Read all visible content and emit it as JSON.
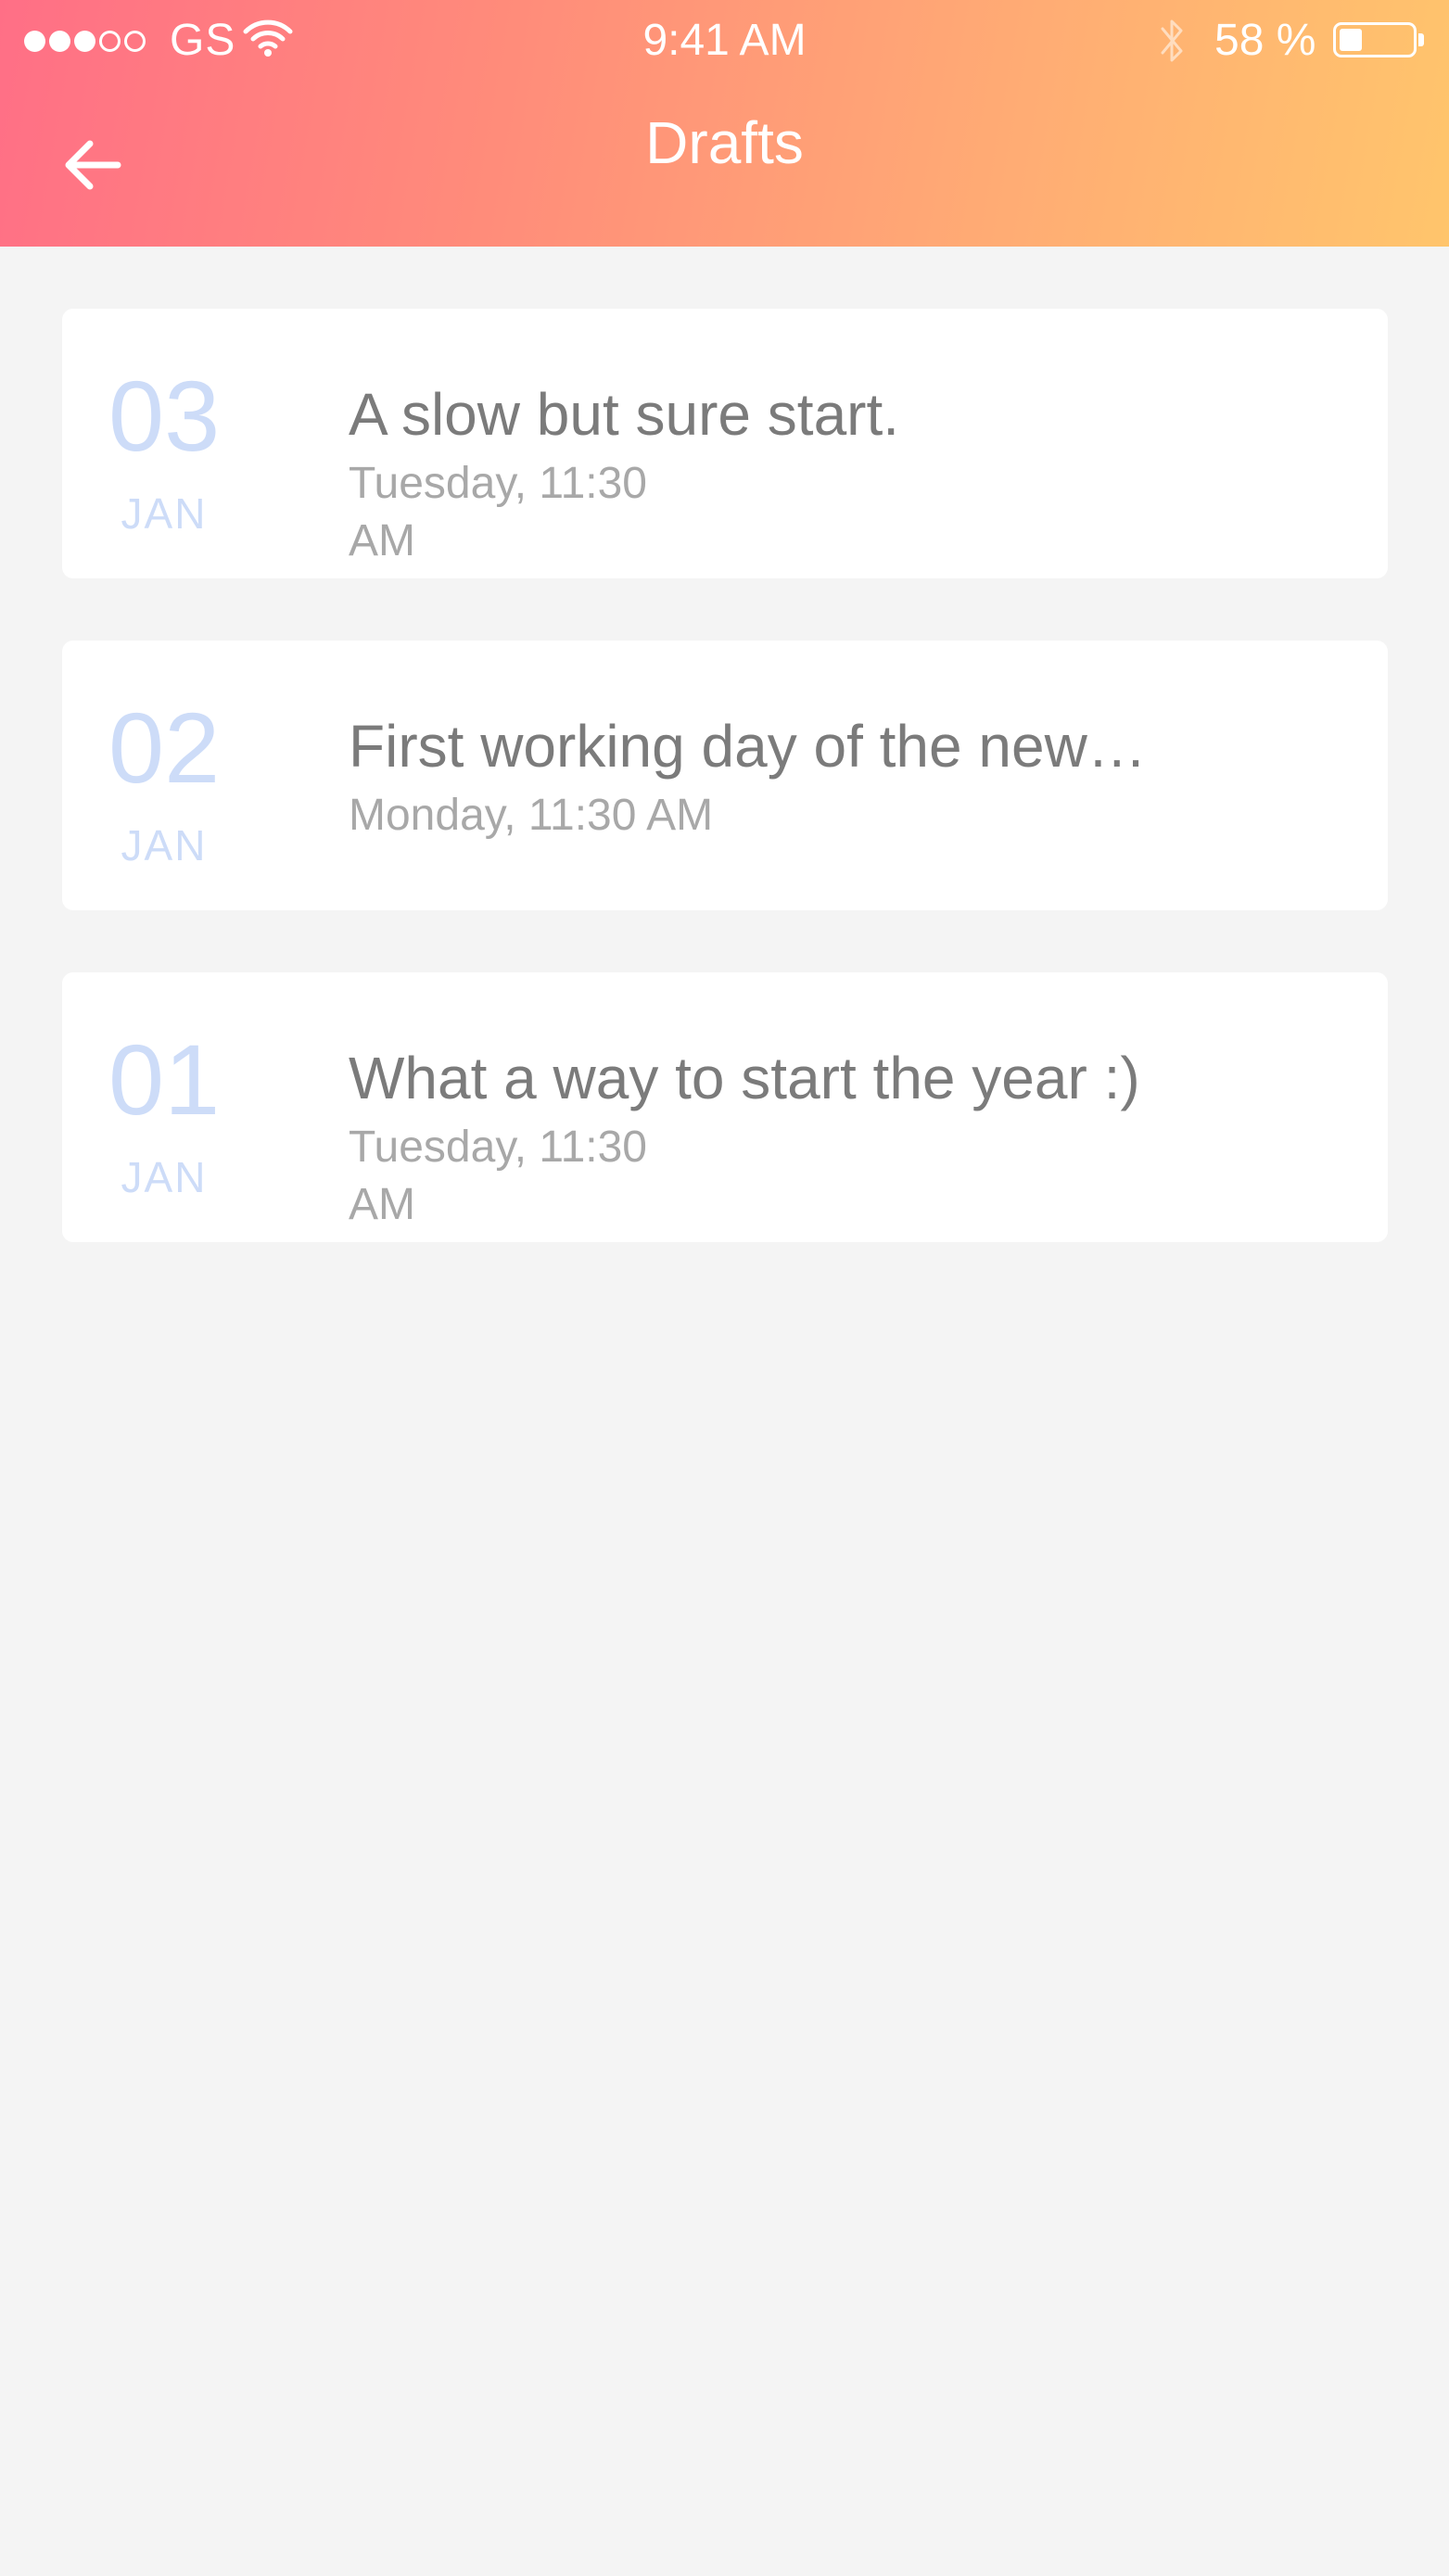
{
  "status_bar": {
    "carrier": "GS",
    "time": "9:41 AM",
    "battery_percent": "58 %",
    "battery_level": 0.58,
    "signal_bars_filled": 3,
    "signal_bars_total": 5
  },
  "header": {
    "title": "Drafts",
    "back_icon": "arrow-left-icon",
    "gradient_colors": [
      "#ff6f86",
      "#ffc56c"
    ]
  },
  "drafts": [
    {
      "day": "03",
      "month": "JAN",
      "title": "A slow but sure start.",
      "meta": "Tuesday, 11:30 AM"
    },
    {
      "day": "02",
      "month": "JAN",
      "title": "First working day of the new…",
      "meta": "Monday, 11:30 AM"
    },
    {
      "day": "01",
      "month": "JAN",
      "title": "What a way to start the year :)",
      "meta": "Tuesday, 11:30 AM"
    }
  ],
  "colors": {
    "background": "#f4f4f4",
    "card": "#ffffff",
    "date_accent": "#cddcf8",
    "title_text": "#7b7b7b",
    "meta_text": "#a8a8a8"
  }
}
